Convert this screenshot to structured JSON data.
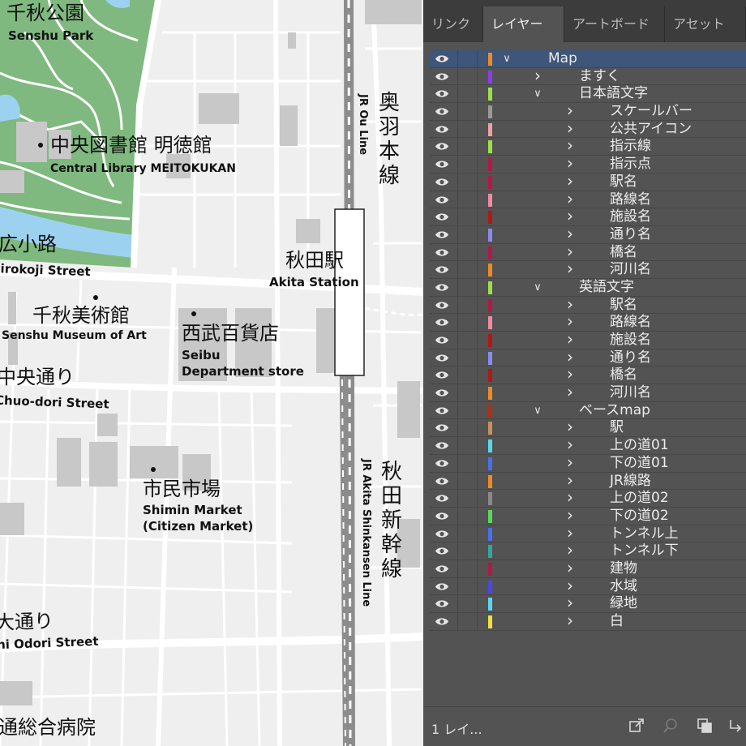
{
  "map": {
    "labels": {
      "senshu_park_ja": "千秋公園",
      "senshu_park_en": "Senshu Park",
      "library_ja": "中央図書館 明徳館",
      "library_en": "Central Library MEITOKUKAN",
      "hirokoji_ja": "広小路",
      "hirokoji_en": "Hirokoji Street",
      "museum_ja": "千秋美術館",
      "museum_en": "Senshu Museum of Art",
      "seibu_ja": "西武百貨店",
      "seibu_en1": "Seibu",
      "seibu_en2": "Department store",
      "station_ja": "秋田駅",
      "station_en": "Akita Station",
      "chuodori_ja": "中央通り",
      "chuodori_en": "Chuo-dori Street",
      "market_ja": "市民市場",
      "market_en1": "Shimin Market",
      "market_en2": "(Citizen Market)",
      "odori_ja": "大通り",
      "odori_en": "ni Odori Street",
      "hospital_ja": "通総合病院",
      "ou_line_ja": [
        "奥",
        "羽",
        "本",
        "線"
      ],
      "ou_line_en": "JR Ou Line",
      "shinkansen_ja": [
        "秋",
        "田",
        "新",
        "幹",
        "線"
      ],
      "shinkansen_en": "JR Akita Shinkansen Line"
    },
    "colors": {
      "park": "#7fb97f",
      "water": "#9cd2f0",
      "building": "#c8c8c8",
      "road": "#ffffff"
    }
  },
  "panel": {
    "tabs": [
      {
        "label": "リンク"
      },
      {
        "label": "レイヤー"
      },
      {
        "label": "アートボード"
      },
      {
        "label": "アセットの"
      }
    ],
    "active_tab": 1,
    "layers": [
      {
        "label": "Map",
        "level": 0,
        "expanded": true,
        "color": "#f08a24",
        "selected": true
      },
      {
        "label": "ますく",
        "level": 1,
        "expanded": false,
        "color": "#8a3cf0"
      },
      {
        "label": "日本語文字",
        "level": 1,
        "expanded": true,
        "color": "#9ee04a"
      },
      {
        "label": "スケールバー",
        "level": 2,
        "expanded": false,
        "color": "#9a9a9a"
      },
      {
        "label": "公共アイコン",
        "level": 2,
        "expanded": false,
        "color": "#f0a0a8"
      },
      {
        "label": "指示線",
        "level": 2,
        "expanded": false,
        "color": "#9ee04a"
      },
      {
        "label": "指示点",
        "level": 2,
        "expanded": false,
        "color": "#b01848"
      },
      {
        "label": "駅名",
        "level": 2,
        "expanded": false,
        "color": "#b01848"
      },
      {
        "label": "路線名",
        "level": 2,
        "expanded": false,
        "color": "#f08aa0"
      },
      {
        "label": "施設名",
        "level": 2,
        "expanded": false,
        "color": "#b01818"
      },
      {
        "label": "通り名",
        "level": 2,
        "expanded": false,
        "color": "#8a8af0"
      },
      {
        "label": "橋名",
        "level": 2,
        "expanded": false,
        "color": "#b01848"
      },
      {
        "label": "河川名",
        "level": 2,
        "expanded": false,
        "color": "#f08a24"
      },
      {
        "label": "英語文字",
        "level": 1,
        "expanded": true,
        "color": "#9ee04a"
      },
      {
        "label": "駅名",
        "level": 2,
        "expanded": false,
        "color": "#b01848"
      },
      {
        "label": "路線名",
        "level": 2,
        "expanded": false,
        "color": "#f08aa0"
      },
      {
        "label": "施設名",
        "level": 2,
        "expanded": false,
        "color": "#b01818"
      },
      {
        "label": "通り名",
        "level": 2,
        "expanded": false,
        "color": "#8a8af0"
      },
      {
        "label": "橋名",
        "level": 2,
        "expanded": false,
        "color": "#b01818"
      },
      {
        "label": "河川名",
        "level": 2,
        "expanded": false,
        "color": "#f08a24"
      },
      {
        "label": "ベースmap",
        "level": 1,
        "expanded": true,
        "color": "#b03010"
      },
      {
        "label": "駅",
        "level": 2,
        "expanded": false,
        "color": "#c89060"
      },
      {
        "label": "上の道01",
        "level": 2,
        "expanded": false,
        "color": "#58d8f0"
      },
      {
        "label": "下の道01",
        "level": 2,
        "expanded": false,
        "color": "#4870f0"
      },
      {
        "label": "JR線路",
        "level": 2,
        "expanded": false,
        "color": "#f08a24"
      },
      {
        "label": "上の道02",
        "level": 2,
        "expanded": false,
        "color": "#8a8a8a"
      },
      {
        "label": "下の道02",
        "level": 2,
        "expanded": false,
        "color": "#5ad85a"
      },
      {
        "label": "トンネル上",
        "level": 2,
        "expanded": false,
        "color": "#4870f0"
      },
      {
        "label": "トンネル下",
        "level": 2,
        "expanded": false,
        "color": "#30a8a0"
      },
      {
        "label": "建物",
        "level": 2,
        "expanded": false,
        "color": "#b01848"
      },
      {
        "label": "水域",
        "level": 2,
        "expanded": false,
        "color": "#4848f0"
      },
      {
        "label": "緑地",
        "level": 2,
        "expanded": false,
        "color": "#58d8f0"
      },
      {
        "label": "白",
        "level": 2,
        "expanded": false,
        "color": "#f0e040"
      }
    ],
    "footer": {
      "layer_count": "1 レイ..."
    }
  }
}
